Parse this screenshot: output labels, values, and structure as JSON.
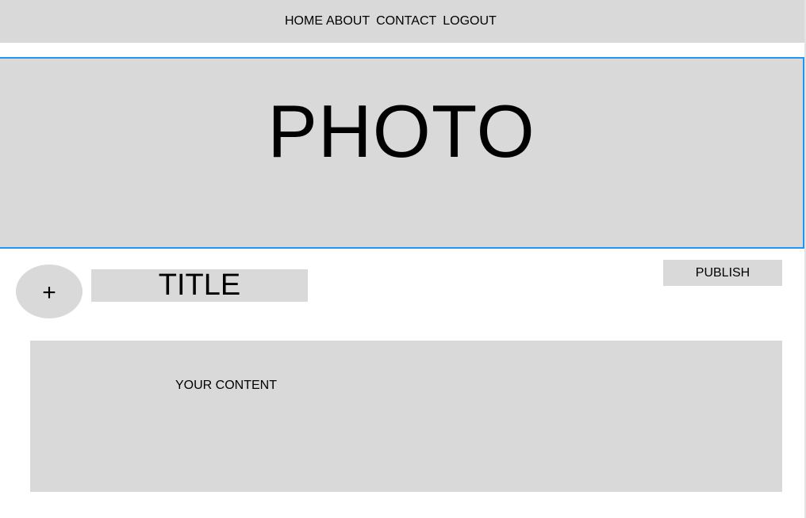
{
  "nav": {
    "items": [
      {
        "label": "HOME"
      },
      {
        "label": "ABOUT"
      },
      {
        "label": "CONTACT"
      },
      {
        "label": "LOGOUT"
      }
    ]
  },
  "banner": {
    "label": "PHOTO",
    "accent_color": "#2196f3"
  },
  "post": {
    "add_icon": "+",
    "title": "TITLE",
    "publish_label": "PUBLISH",
    "content_placeholder": "YOUR CONTENT"
  }
}
